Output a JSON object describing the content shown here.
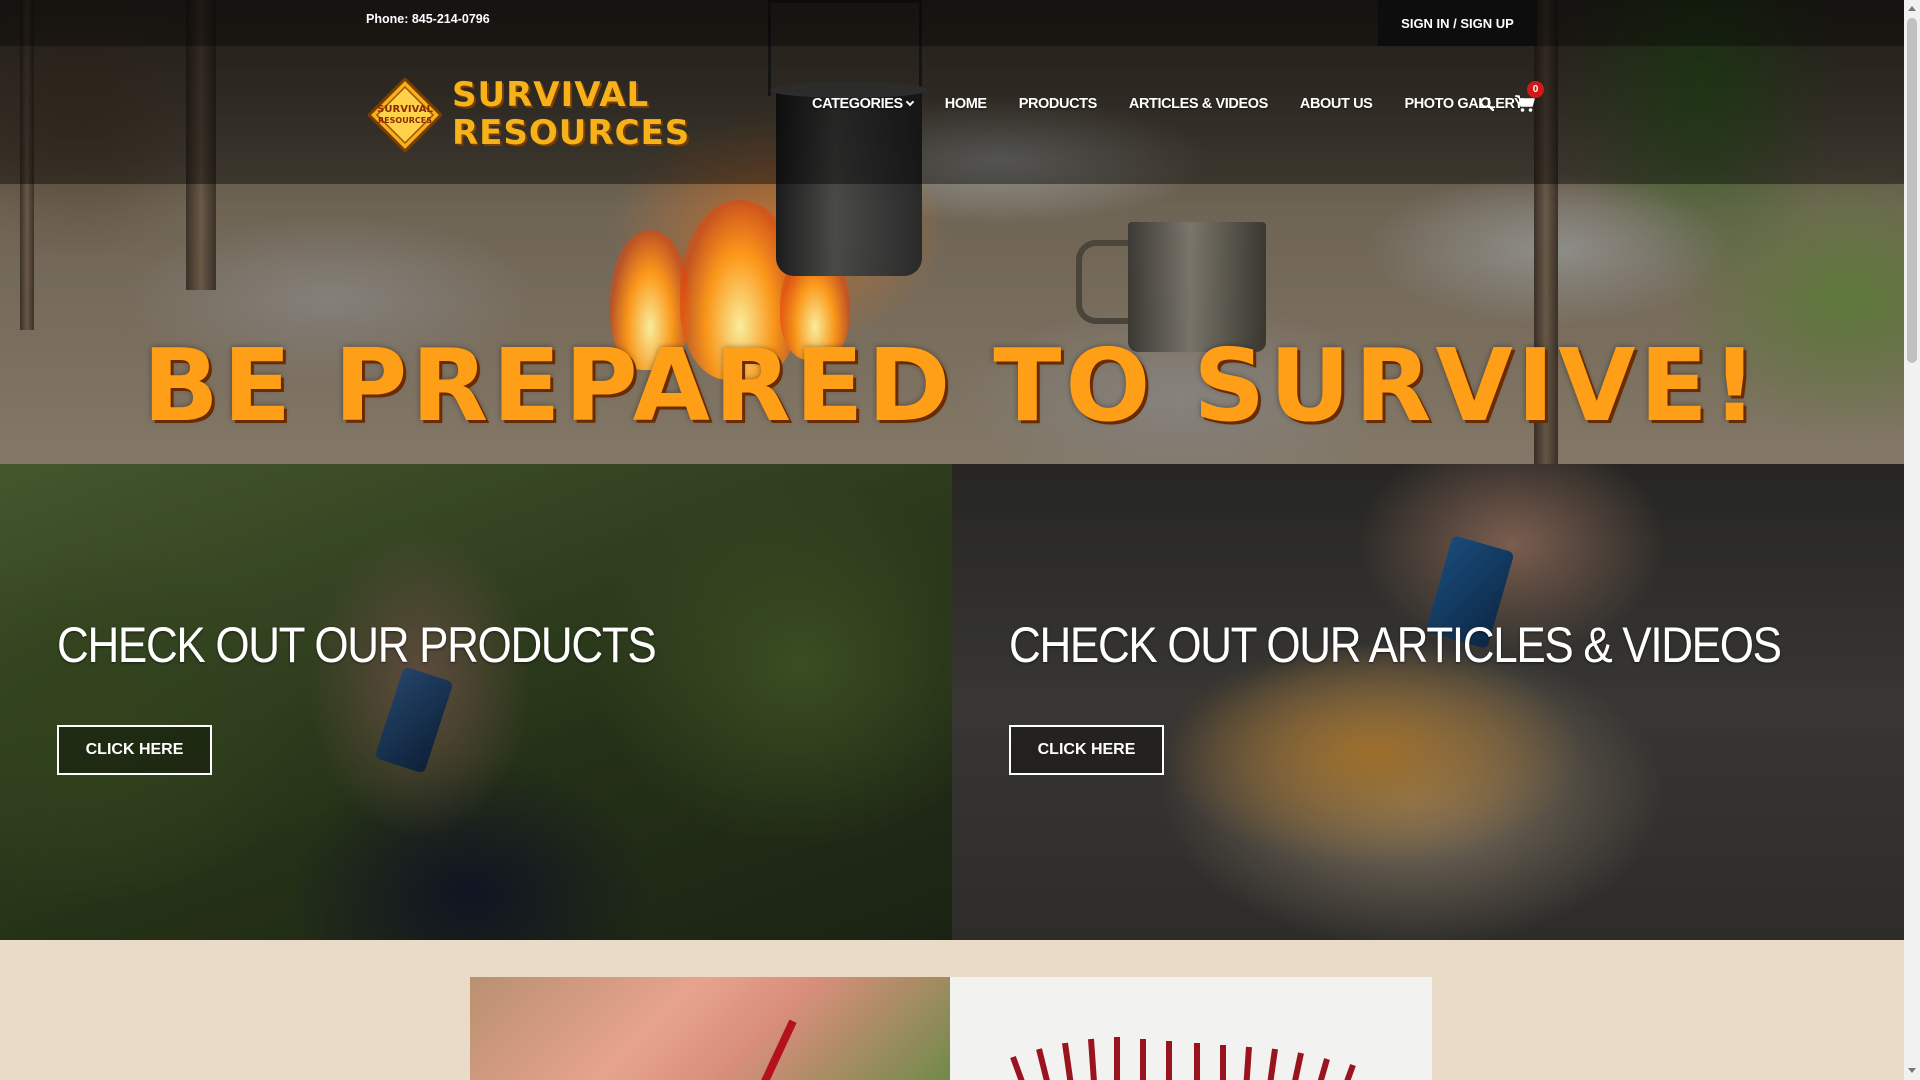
{
  "topbar": {
    "phone": "Phone: 845-214-0796",
    "signin_label": "SIGN IN / SIGN UP"
  },
  "logo": {
    "line1": "SURVIVAL",
    "line2": "RESOURCES",
    "diamond_line1": "SURVIVAL",
    "diamond_line2": "RESOURCES"
  },
  "nav": {
    "items": [
      {
        "label": "CATEGORIES",
        "has_dropdown": true
      },
      {
        "label": "HOME"
      },
      {
        "label": "PRODUCTS"
      },
      {
        "label": "ARTICLES & VIDEOS"
      },
      {
        "label": "ABOUT US"
      },
      {
        "label": "PHOTO GALLERY"
      }
    ],
    "search_icon": "search-icon",
    "cart_icon": "cart-icon",
    "cart_count": "0"
  },
  "hero": {
    "tagline": "BE PREPARED TO SURVIVE!"
  },
  "promos": [
    {
      "title": "CHECK OUT OUR PRODUCTS",
      "button_label": "CLICK HERE"
    },
    {
      "title": "CHECK OUT OUR ARTICLES & VIDEOS",
      "button_label": "CLICK HERE"
    }
  ],
  "colors": {
    "accent_orange": "#ff9f18",
    "logo_gold": "#f7b21a",
    "badge_red": "#d41818",
    "footer_bg": "#eadbc8"
  }
}
